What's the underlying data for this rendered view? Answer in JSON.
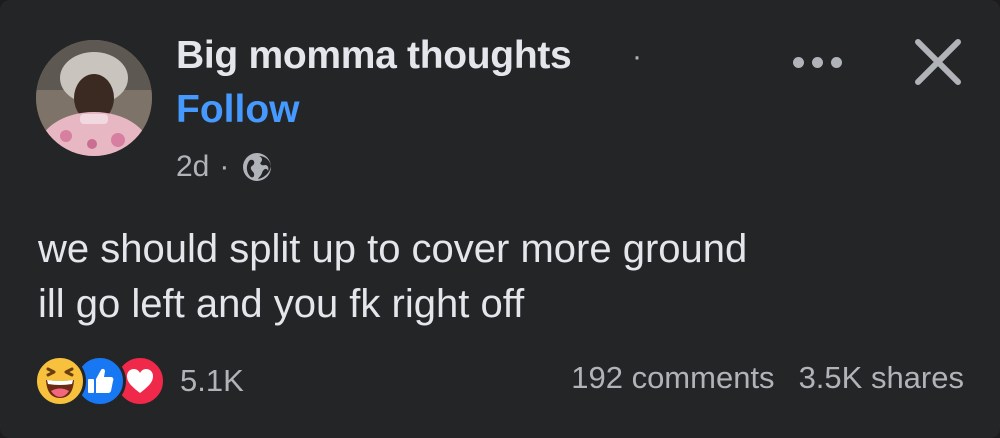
{
  "post": {
    "page_name": "Big momma thoughts",
    "name_separator": "·",
    "follow_label": "Follow",
    "time_ago": "2d",
    "meta_separator": "·",
    "audience_icon": "globe-icon",
    "text_lines": [
      "we should split up to cover more ground",
      "ill go left and you fk right off"
    ]
  },
  "header_actions": {
    "more_icon": "more-horizontal-icon",
    "close_icon": "close-icon"
  },
  "engagement": {
    "reaction_icons": [
      "haha-reaction-icon",
      "like-reaction-icon",
      "love-reaction-icon"
    ],
    "reactions_count": "5.1K",
    "comments": "192 comments",
    "shares": "3.5K shares"
  },
  "colors": {
    "background": "#242526",
    "primary_text": "#e4e6eb",
    "secondary_text": "#b0b3b8",
    "link_blue": "#4599ff",
    "haha_yellow": "#f7c13e",
    "like_blue": "#1877f2",
    "love_red": "#f02849"
  }
}
